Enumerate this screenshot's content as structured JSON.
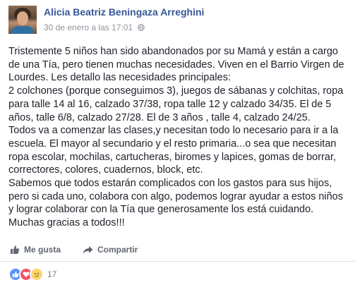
{
  "post": {
    "author": "Alicia Beatriz Beningaza Arreghini",
    "timestamp": "30 de enero a las 17:01",
    "privacy_icon": "globe-icon",
    "body": "Tristemente 5 niños han sido abandonados por su Mamá y están a cargo\nde una Tía, pero tienen muchas necesidades. Viven en el Barrio Virgen de\nLourdes. Les detallo las necesidades principales:\n2 colchones (porque conseguimos 3), juegos de sábanas y colchitas, ropa\npara talle 14 al 16, calzado 37/38, ropa talle 12 y calzado 34/35. El de 5\naños, talle 6/8, calzado 27/28. El de 3 años , talle 4, calzado 24/25.\nTodos va a comenzar las clases,y necesitan todo lo necesario para ir a la\nescuela. El mayor al secundario y el resto primaria...o sea que necesitan\nropa escolar, mochilas, cartucheras, biromes y lapices, gomas de borrar,\ncorrectores, colores, cuadernos, block, etc.\nSabemos que todos estarán complicados con los gastos para sus hijos,\npero si cada uno, colabora con algo, podemos lograr ayudar a estos niños\ny lograr colaborar con la Tía que generosamente los está cuidando.\nMuchas gracias a todos!!!"
  },
  "actions": {
    "like_label": "Me gusta",
    "like_icon": "thumbs-up-icon",
    "share_label": "Compartir",
    "share_icon": "share-arrow-icon"
  },
  "reactions": {
    "types": [
      "like",
      "love",
      "sad"
    ],
    "count": "17"
  },
  "colors": {
    "author": "#365899",
    "meta": "#90949c",
    "action": "#606770",
    "like": "#5890ff",
    "love": "#f25268",
    "sad": "#fcd56b"
  }
}
